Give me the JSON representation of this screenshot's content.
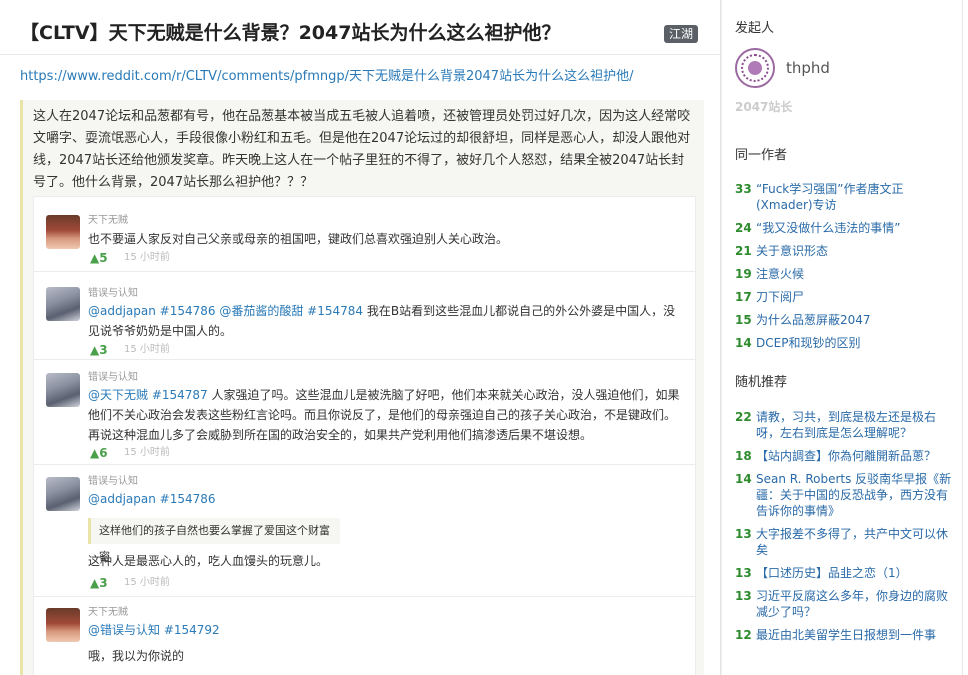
{
  "post": {
    "title": "【CLTV】天下无贼是什么背景？2047站长为什么这么袒护他？",
    "tag": "江湖",
    "url": "https://www.reddit.com/r/CLTV/comments/pfmngp/天下无贼是什么背景2047站长为什么这么袒护他/",
    "body": "这人在2047论坛和品葱都有号，他在品葱基本被当成五毛被人追着喷，还被管理员处罚过好几次，因为这人经常咬文嚼字、耍流氓恶心人，手段很像小粉红和五毛。但是他在2047论坛过的却很舒坦，同样是恶心人，却没人跟他对线，2047站长还给他颁发奖章。昨天晚上这人在一个帖子里狂的不得了，被好几个人怒怼，结果全被2047站长封号了。他什么背景，2047站长那么袒护他？？？"
  },
  "comments": [
    {
      "author": "天下无贼",
      "ref": "",
      "text": "也不要逼人家反对自己父亲或母亲的祖国吧，键政们总喜欢强迫别人关心政治。",
      "votes": "▲5",
      "time": "15 小时前"
    },
    {
      "author": "错误与认知",
      "ref": "@addjapan #154786 @番茄酱的酸甜 #154784",
      "text": " 我在B站看到这些混血儿都说自己的外公外婆是中国人，没见说爷爷奶奶是中国人的。",
      "votes": "▲3",
      "time": "15 小时前"
    },
    {
      "author": "错误与认知",
      "ref": "@天下无贼 #154787",
      "text": " 人家强迫了吗。这些混血儿是被洗脑了好吧，他们本来就关心政治，没人强迫他们，如果他们不关心政治会发表这些粉红言论吗。而且你说反了，是他们的母亲强迫自己的孩子关心政治，不是键政们。再说这种混血儿多了会威胁到所在国的政治安全的，如果共产党利用他们搞渗透后果不堪设想。",
      "votes": "▲6",
      "time": "15 小时前"
    },
    {
      "author": "错误与认知",
      "ref": "@addjapan #154786",
      "quote": "这样他们的孩子自然也要么掌握了爱国这个财富密",
      "text": "这种人是最恶心人的，吃人血馒头的玩意儿。",
      "votes": "▲3",
      "time": "15 小时前"
    },
    {
      "author": "天下无贼",
      "ref": "@错误与认知 #154792",
      "text": "哦，我以为你说的"
    }
  ],
  "sidebar": {
    "initiator_heading": "发起人",
    "initiator_name": "thphd",
    "initiator_role": "2047站长",
    "same_author_heading": "同一作者",
    "same_author": [
      {
        "count": "33",
        "title": "“Fuck学习强国”作者唐文正(Xmader)专访"
      },
      {
        "count": "24",
        "title": "“我又没做什么违法的事情”"
      },
      {
        "count": "21",
        "title": "关于意识形态"
      },
      {
        "count": "19",
        "title": "注意火候"
      },
      {
        "count": "17",
        "title": "刀下阅尸"
      },
      {
        "count": "15",
        "title": "为什么品葱屏蔽2047"
      },
      {
        "count": "14",
        "title": "DCEP和现钞的区别"
      }
    ],
    "random_heading": "随机推荐",
    "random": [
      {
        "count": "22",
        "title": "请教，习共，到底是极左还是极右呀，左右到底是怎么理解呢？"
      },
      {
        "count": "18",
        "title": "【站内調查】你為何離開新品蔥？"
      },
      {
        "count": "14",
        "title": "Sean R. Roberts 反驳南华早报《新疆：关于中国的反恐战争，西方没有告诉你的事情》"
      },
      {
        "count": "13",
        "title": "大字报差不多得了，共产中文可以休矣"
      },
      {
        "count": "13",
        "title": "【口述历史】品韭之恋（1）"
      },
      {
        "count": "13",
        "title": "习近平反腐这么多年，你身边的腐败减少了吗？"
      },
      {
        "count": "12",
        "title": "最近由北美留学生日报想到一件事"
      }
    ]
  }
}
